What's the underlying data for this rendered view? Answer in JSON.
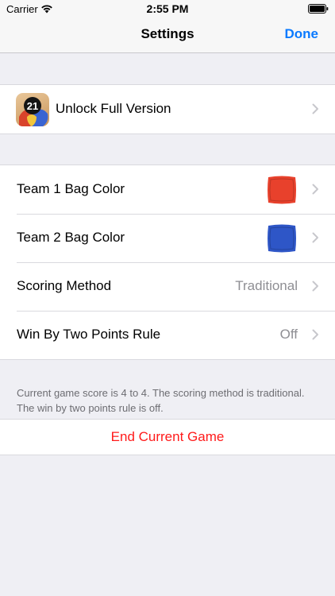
{
  "status_bar": {
    "carrier": "Carrier",
    "time": "2:55 PM"
  },
  "nav": {
    "title": "Settings",
    "done_label": "Done"
  },
  "unlock": {
    "label": "Unlock Full Version",
    "icon_badge": "21"
  },
  "settings": {
    "team1": {
      "label": "Team 1 Bag Color",
      "color": "#e8412c"
    },
    "team2": {
      "label": "Team 2 Bag Color",
      "color": "#2e56c7"
    },
    "scoring": {
      "label": "Scoring Method",
      "value": "Traditional"
    },
    "win_by_two": {
      "label": "Win By Two Points Rule",
      "value": "Off"
    }
  },
  "footer_note": "Current game score is 4 to 4. The scoring method is traditional. The win by two points rule is off.",
  "end_game_label": "End Current Game",
  "colors": {
    "accent": "#0a7aff",
    "destructive": "#ff1a1a",
    "background": "#efeff4"
  }
}
